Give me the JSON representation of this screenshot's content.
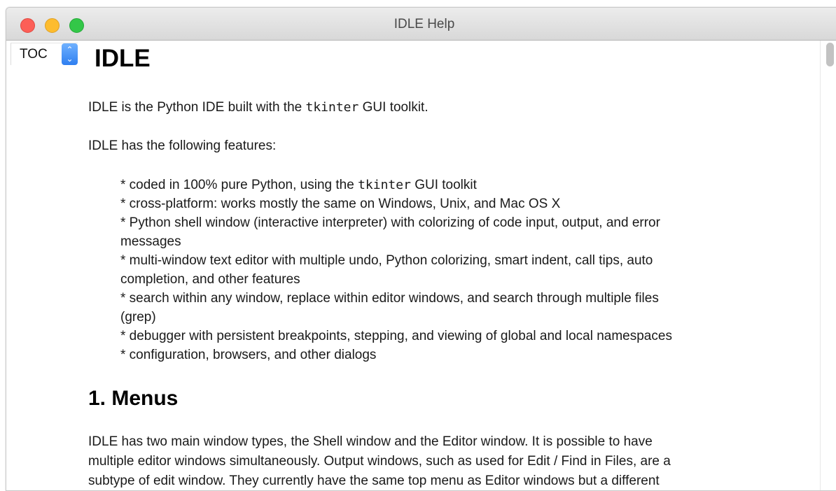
{
  "window": {
    "title": "IDLE Help"
  },
  "toc": {
    "label": "TOC"
  },
  "doc": {
    "title": "IDLE",
    "intro_pre": "IDLE is the Python IDE built with the ",
    "intro_code": "tkinter",
    "intro_post": " GUI toolkit.",
    "features_intro": "IDLE has the following features:",
    "features": [
      [
        "* coded in 100% pure Python, using the ",
        "tkinter",
        " GUI toolkit"
      ],
      [
        "* cross-platform: works mostly the same on Windows, Unix, and Mac OS X"
      ],
      [
        "* Python shell window (interactive interpreter) with colorizing of code input, output, and error"
      ],
      [
        "messages"
      ],
      [
        "* multi-window text editor with multiple undo, Python colorizing, smart indent, call tips, auto"
      ],
      [
        "completion, and other features"
      ],
      [
        "* search within any window, replace within editor windows, and search through multiple files"
      ],
      [
        "(grep)"
      ],
      [
        "* debugger with persistent breakpoints, stepping, and viewing of global and local namespaces"
      ],
      [
        "* configuration, browsers, and other dialogs"
      ]
    ],
    "section_menus": "1. Menus",
    "menus_lines": [
      "IDLE has two main window types, the Shell window and the Editor window.  It is possible to have",
      "multiple editor windows simultaneously.  Output windows, such as used for Edit / Find in Files, are a",
      "subtype of edit window.  They currently have the same top menu as Editor windows but a different"
    ]
  }
}
